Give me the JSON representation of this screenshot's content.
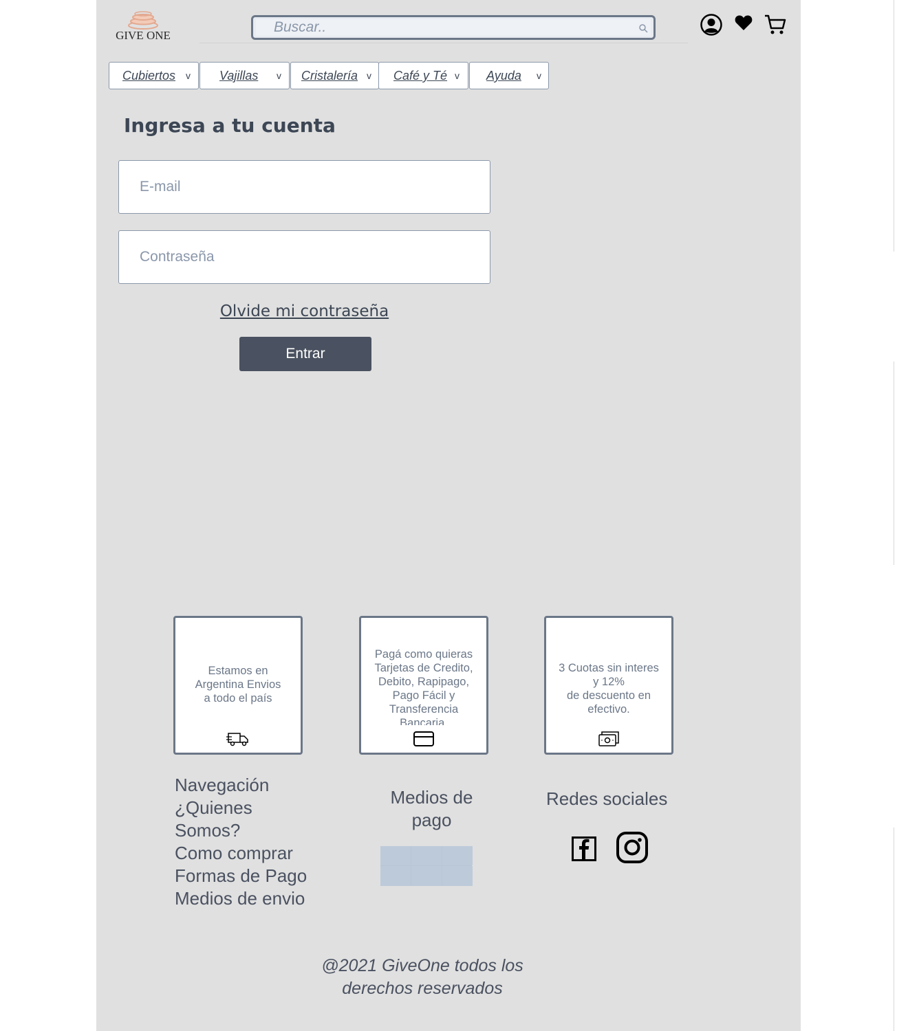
{
  "header": {
    "logo_text": "GIVE ONE",
    "search_placeholder": "Buscar..",
    "icons": [
      "user-icon",
      "heart-icon",
      "cart-icon",
      "search-icon"
    ]
  },
  "nav": {
    "items": [
      {
        "label": "Cubiertos"
      },
      {
        "label": "Vajillas"
      },
      {
        "label": "Cristalería"
      },
      {
        "label": "Café y Té"
      },
      {
        "label": "Ayuda"
      }
    ],
    "chevron": "v"
  },
  "login": {
    "title": "Ingresa a tu cuenta",
    "email_placeholder": "E-mail",
    "password_placeholder": "Contraseña",
    "forgot_label": "Olvide mi contraseña",
    "submit_label": "Entrar"
  },
  "info_cards": [
    {
      "text": "Estamos en\nArgentina    Envios\na todo el país",
      "icon": "truck-icon"
    },
    {
      "text": "Pagá como quieras\nTarjetas de Credito,\nDebito, Rapipago,\nPago Fácil y\nTransferencia\nBancaria.",
      "icon": "credit-card-icon"
    },
    {
      "text": "3 Cuotas sin interes\ny 12%\nde descuento en\nefectivo.",
      "icon": "cash-icon"
    }
  ],
  "footer": {
    "nav_links": [
      "Navegación",
      "¿Quienes Somos?",
      "Como comprar",
      "Formas de Pago",
      "Medios de envio"
    ],
    "payment_title": "Medios de pago",
    "social_title": "Redes sociales",
    "social_icons": [
      "facebook-icon",
      "instagram-icon"
    ],
    "copyright": "@2021 GiveOne todos los derechos reservados"
  },
  "colors": {
    "page_bg": "#e0e0e0",
    "text": "#3c4654",
    "muted": "#8a97aa",
    "button": "#4a5160",
    "logo_accent": "#e3a88f"
  }
}
